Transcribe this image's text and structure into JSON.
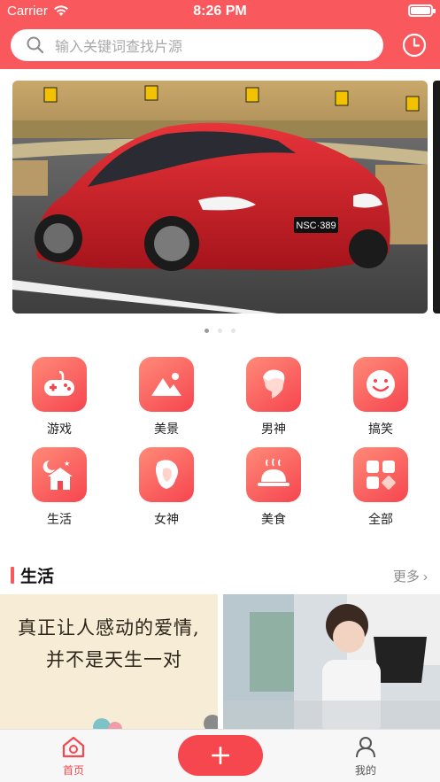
{
  "status_bar": {
    "carrier": "Carrier",
    "time": "8:26 PM"
  },
  "search": {
    "placeholder": "输入关键词查找片源",
    "icon": "search-icon"
  },
  "header": {
    "history_icon": "clock-icon",
    "accent": "#f9595c"
  },
  "banner": {
    "slide_count": 3,
    "active_index": 0,
    "plate_text": "NSC·389"
  },
  "categories": [
    {
      "label": "游戏",
      "icon": "gamepad-icon"
    },
    {
      "label": "美景",
      "icon": "mountain-icon"
    },
    {
      "label": "男神",
      "icon": "man-icon"
    },
    {
      "label": "搞笑",
      "icon": "smile-icon"
    },
    {
      "label": "生活",
      "icon": "house-icon"
    },
    {
      "label": "女神",
      "icon": "woman-icon"
    },
    {
      "label": "美食",
      "icon": "food-dome-icon"
    },
    {
      "label": "全部",
      "icon": "grid-icon"
    }
  ],
  "section": {
    "title": "生活",
    "more": "更多"
  },
  "cards": [
    {
      "line1": "真正让人感动的爱情,",
      "line2": "并不是天生一对"
    },
    {
      "alt": "photo"
    }
  ],
  "tabbar": {
    "home": {
      "label": "首页",
      "color": "#f6474f"
    },
    "add": {
      "icon": "plus-icon"
    },
    "mine": {
      "label": "我的",
      "color": "#555555"
    }
  }
}
